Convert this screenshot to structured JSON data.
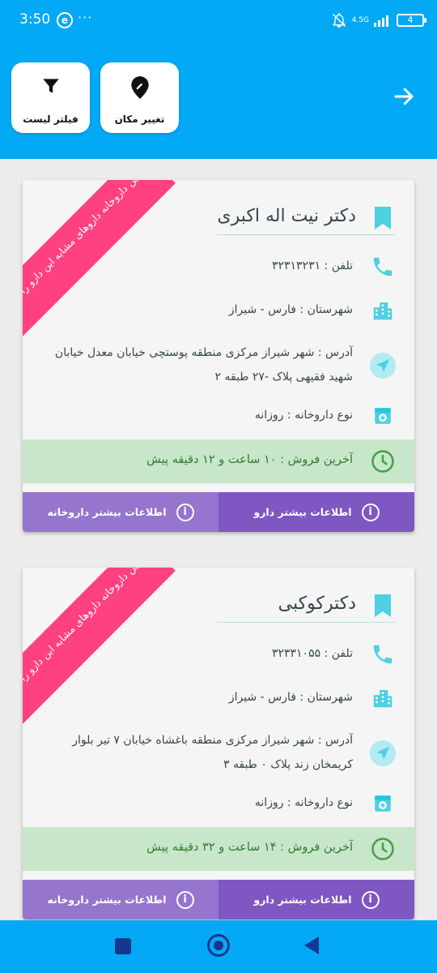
{
  "status_bar": {
    "time": "3:50",
    "dots": "···",
    "network": "4.5G",
    "battery": "4"
  },
  "header": {
    "filter_label": "فیلتر لیست",
    "location_label": "تغییر مکان"
  },
  "cards": [
    {
      "ribbon": "این داروخانه داروهای مشابه این دارو را دارد",
      "name": "دکتر نیت اله اکبری",
      "phone": "تلفن : ۳۲۳۱۳۲۳۱",
      "city": "شهرستان : فارس - شیراز",
      "address": "آدرس : شهر شیراز مرکزی منطقه پوستچی خیابان معدل خیابان شهید فقیهی پلاک -۲۷ طبقه ۲",
      "type": "نوع داروخانه : روزانه",
      "last_sale": "آخرین فروش : ۱۰ ساعت و ۱۲ دقیقه پیش",
      "btn_drug": "اطلاعات بیشتر دارو",
      "btn_pharmacy": "اطلاعات بیشتر داروخانه"
    },
    {
      "ribbon": "این داروخانه داروهای مشابه این دارو را دارد",
      "name": "دکترکوکبی",
      "phone": "تلفن : ۳۲۳۳۱۰۵۵",
      "city": "شهرستان : فارس - شیراز",
      "address": "آدرس : شهر شیراز مرکزی منطقه باغشاه خیابان ۷ تیر بلوار کریمخان زند پلاک ۰ طبقه ۳",
      "type": "نوع داروخانه : روزانه",
      "last_sale": "آخرین فروش : ۱۴ ساعت و ۳۲ دقیقه پیش",
      "btn_drug": "اطلاعات بیشتر دارو",
      "btn_pharmacy": "اطلاعات بیشتر داروخانه"
    }
  ],
  "colors": {
    "primary": "#03a9f4",
    "accent_pink": "#ff4081",
    "teal_icon": "#4dd0e1",
    "green_bg": "#c8e6c9",
    "green_text": "#2e7d32",
    "purple_dark": "#7e57c2",
    "purple_light": "#9575cd"
  }
}
